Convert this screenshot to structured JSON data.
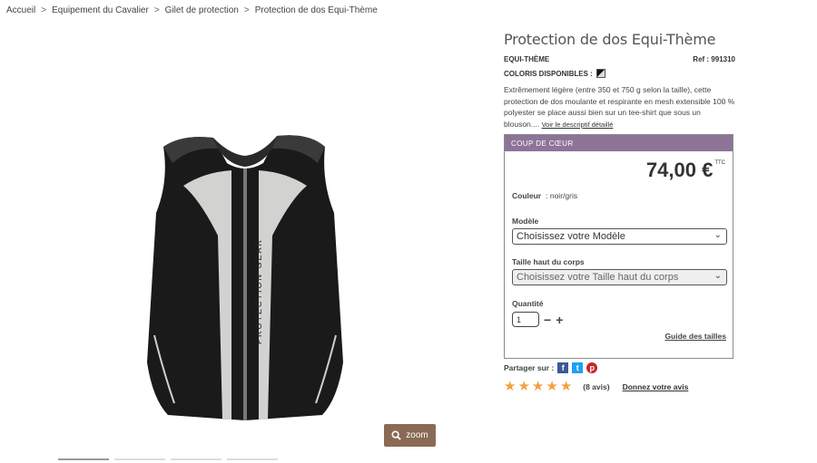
{
  "breadcrumb": [
    {
      "label": "Accueil"
    },
    {
      "label": "Equipement du Cavalier"
    },
    {
      "label": "Gilet de protection"
    },
    {
      "label": "Protection de dos Equi-Thème"
    }
  ],
  "breadcrumb_separator": ">",
  "gallery": {
    "zoom_label": "zoom",
    "vest_print": "PROTECTION GEAR"
  },
  "product": {
    "title": "Protection de dos Equi-Thème",
    "brand": "EQUI-THÈME",
    "ref": "Ref : 991310",
    "colors_label": "COLORIS DISPONIBLES :",
    "description": "Extrêmement légère (entre 350 et 750 g selon la taille), cette protection de dos moulante et respirante en mesh extensible 100 % polyester se place aussi bien sur un tee-shirt que sous un blouson.... ",
    "more_link": "Voir le descriptif détaillé"
  },
  "buy_box": {
    "header": "COUP DE CŒUR",
    "header_color": "#8e7398",
    "price": "74,00 €",
    "price_suffix": "TTC",
    "couleur_label": "Couleur",
    "couleur_value": ": noir/gris",
    "modele_label": "Modèle",
    "modele_value": "Choisissez votre Modèle",
    "taille_label": "Taille haut du corps",
    "taille_value": "Choisissez votre Taille haut du corps",
    "quantite_label": "Quantité",
    "quantite_value": "1",
    "minus": "−",
    "plus": "+",
    "guide_link": "Guide des tailles"
  },
  "share": {
    "label": "Partager sur :",
    "icons": [
      "facebook-icon",
      "twitter-icon",
      "pinterest-icon"
    ]
  },
  "rating": {
    "stars": 5,
    "count": "(8 avis)",
    "review_link": "Donnez votre avis",
    "star_color": "#f0a046"
  }
}
